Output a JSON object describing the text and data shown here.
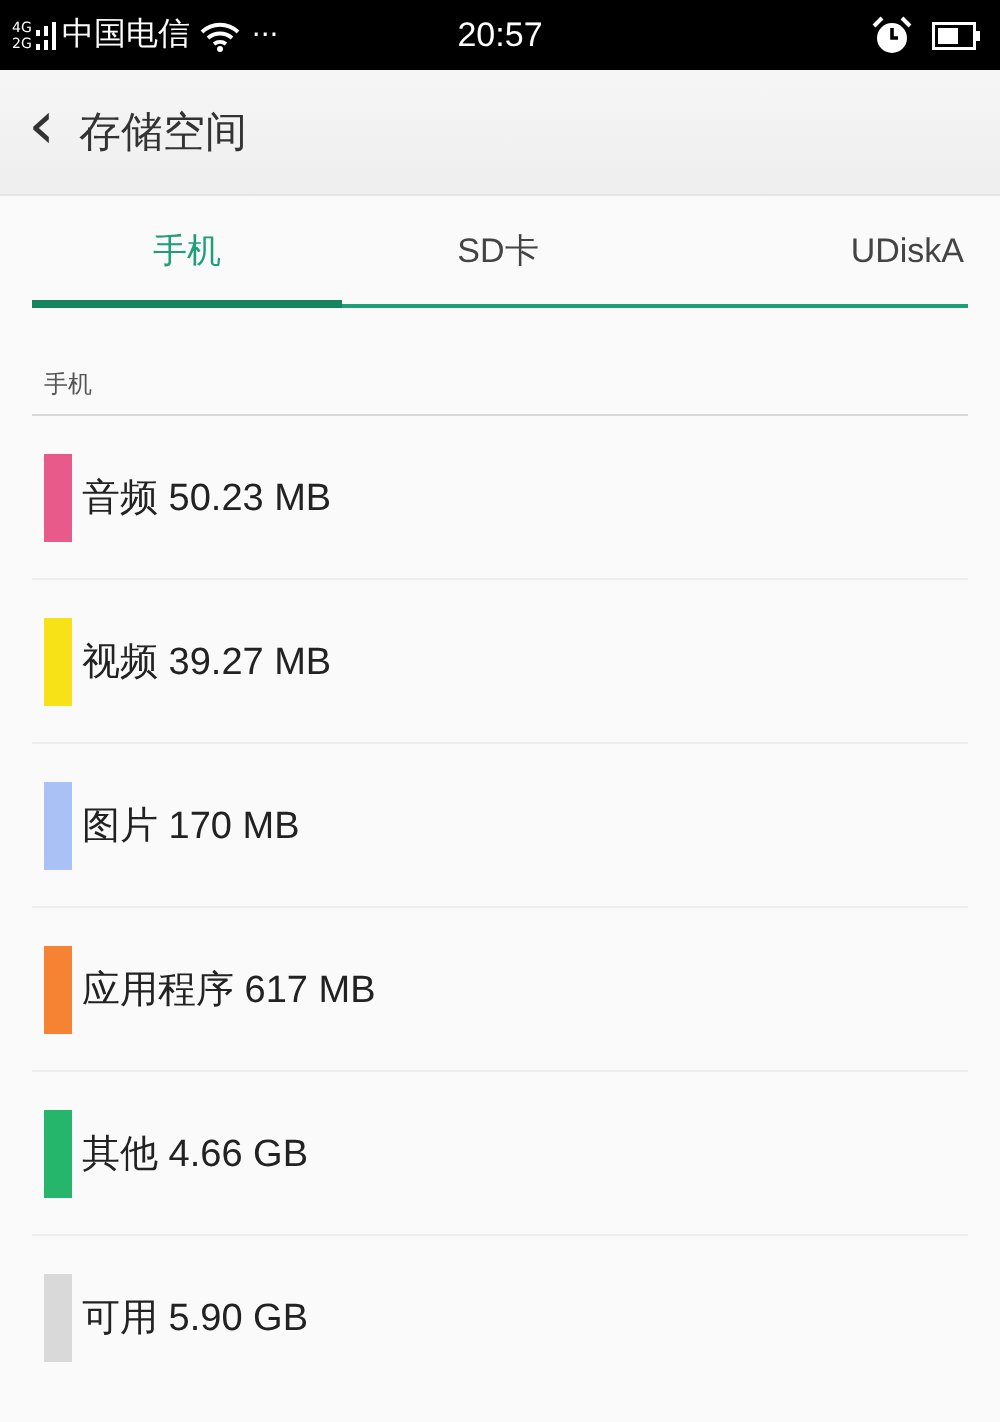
{
  "status_bar": {
    "network_top": "4G",
    "network_bottom": "2G",
    "carrier": "中国电信",
    "more": "···",
    "time": "20:57"
  },
  "header": {
    "back": "‹",
    "title": "存储空间"
  },
  "tabs": [
    {
      "label": "手机",
      "selected": true
    },
    {
      "label": "SD卡",
      "selected": false
    },
    {
      "label": "UDiskA",
      "selected": false
    }
  ],
  "section": {
    "title": "手机"
  },
  "items": [
    {
      "label": "音频 50.23 MB",
      "color": "#e75a8a"
    },
    {
      "label": "视频 39.27 MB",
      "color": "#f7e117"
    },
    {
      "label": "图片 170 MB",
      "color": "#a9c1f5"
    },
    {
      "label": "应用程序 617 MB",
      "color": "#f58333"
    },
    {
      "label": "其他 4.66 GB",
      "color": "#25b56b"
    },
    {
      "label": "可用 5.90 GB",
      "color": "#d9d9d9"
    }
  ]
}
